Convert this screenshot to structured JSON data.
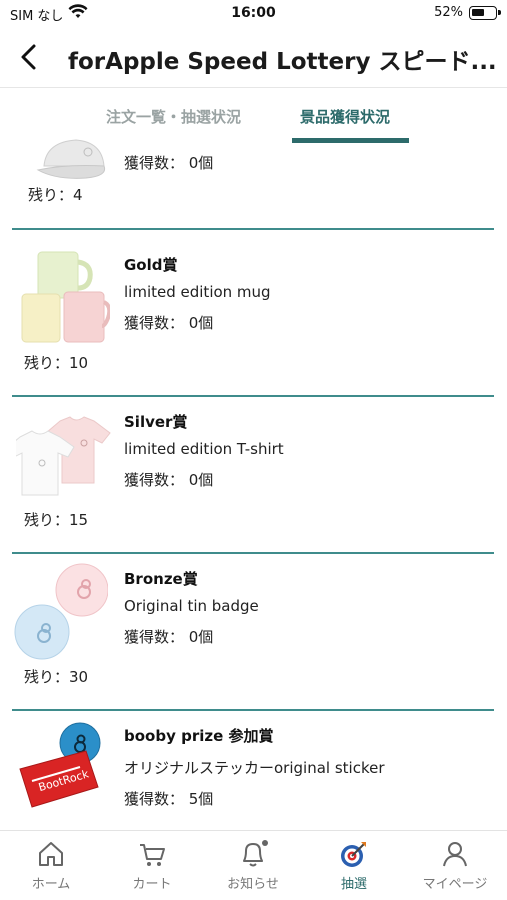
{
  "status": {
    "carrier": "SIM なし",
    "time": "16:00",
    "battery": "52%"
  },
  "header": {
    "title": "forApple Speed Lottery スピード..."
  },
  "tabs": [
    {
      "label": "注文一覧・抽選状況",
      "active": false
    },
    {
      "label": "景品獲得状況",
      "active": true
    }
  ],
  "prizes": [
    {
      "name": "",
      "desc": "",
      "count": "獲得数： 0個",
      "remain": "残り：4",
      "image": "cap-icon"
    },
    {
      "name": "Gold賞",
      "desc": "limited edition mug",
      "count": "獲得数： 0個",
      "remain": "残り：10",
      "image": "mug-icon"
    },
    {
      "name": "Silver賞",
      "desc": "limited edition T-shirt",
      "count": "獲得数： 0個",
      "remain": "残り：15",
      "image": "tshirt-icon"
    },
    {
      "name": "Bronze賞",
      "desc": "Original tin badge",
      "count": "獲得数： 0個",
      "remain": "残り：30",
      "image": "badge-icon"
    },
    {
      "name": "booby prize 参加賞",
      "desc": "オリジナルステッカーoriginal sticker",
      "count": "獲得数： 5個",
      "remain": "",
      "image": "sticker-icon"
    }
  ],
  "bottom_nav": [
    {
      "label": "ホーム",
      "icon": "home-icon",
      "active": false
    },
    {
      "label": "カート",
      "icon": "cart-icon",
      "active": false
    },
    {
      "label": "お知らせ",
      "icon": "bell-icon",
      "active": false
    },
    {
      "label": "抽選",
      "icon": "target-icon",
      "active": true
    },
    {
      "label": "マイページ",
      "icon": "person-icon",
      "active": false
    }
  ],
  "colors": {
    "accent": "#2d6b6b",
    "divider": "#3f8c8c",
    "tab_inactive": "#9aa3a3"
  }
}
